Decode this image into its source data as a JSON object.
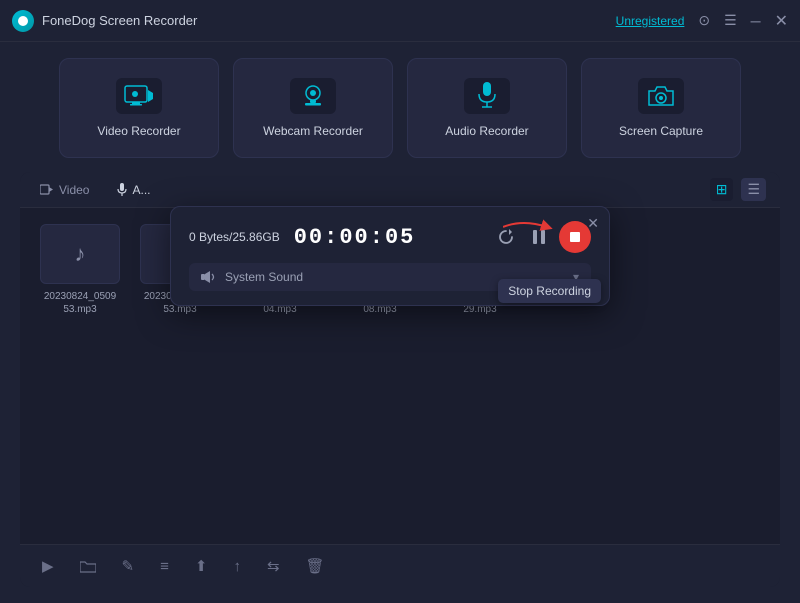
{
  "app": {
    "title": "FoneDog Screen Recorder",
    "unregistered_label": "Unregistered"
  },
  "tiles": [
    {
      "id": "video-recorder",
      "label": "Video Recorder",
      "icon": "monitor"
    },
    {
      "id": "webcam-recorder",
      "label": "Webcam Recorder",
      "icon": "webcam"
    },
    {
      "id": "audio-recorder",
      "label": "Audio Recorder",
      "icon": "mic"
    },
    {
      "id": "screen-capture",
      "label": "Screen Capture",
      "icon": "camera"
    }
  ],
  "tabs": [
    {
      "id": "video",
      "label": "Video",
      "icon": "video",
      "active": false
    },
    {
      "id": "audio",
      "label": "A...",
      "icon": "mic",
      "active": true
    }
  ],
  "recording_popup": {
    "storage": "0 Bytes/25.86GB",
    "timer": "00:00:05",
    "system_sound_label": "System Sound",
    "stop_recording_tooltip": "Stop Recording"
  },
  "files": [
    {
      "name": "20230824_0509\n53.mp3",
      "has_thumb": true
    },
    {
      "name": "20230823_0559\n53.mp3",
      "has_thumb": false
    },
    {
      "name": "20230818_0203\n04.mp3",
      "has_thumb": false
    },
    {
      "name": "20230817_0439\n08.mp3",
      "has_thumb": false
    },
    {
      "name": "20230817_0438\n29.mp3",
      "has_thumb": false
    }
  ],
  "toolbar": {
    "buttons": [
      "▶",
      "🗁",
      "✎",
      "≡",
      "⬆",
      "⬆",
      "⇆",
      "🗑"
    ]
  }
}
